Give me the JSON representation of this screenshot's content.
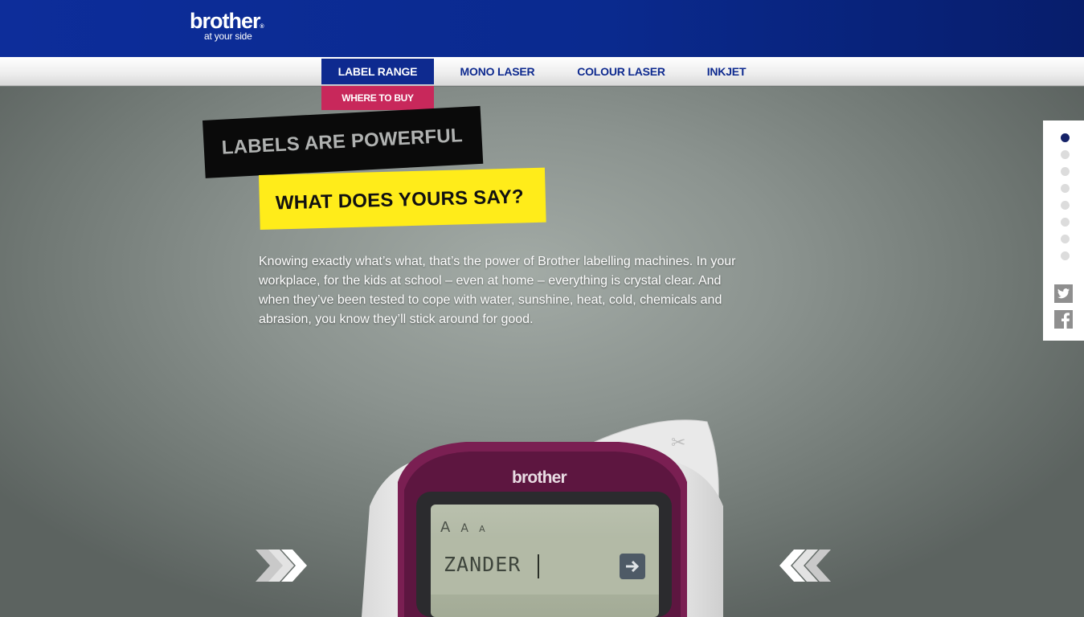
{
  "header": {
    "logo_word": "brother",
    "logo_trademark": "®",
    "logo_tagline": "at your side"
  },
  "nav": {
    "items": [
      {
        "label": "LABEL RANGE",
        "active": true
      },
      {
        "label": "MONO LASER",
        "active": false
      },
      {
        "label": "COLOUR LASER",
        "active": false
      },
      {
        "label": "INKJET",
        "active": false
      }
    ],
    "subnav_label": "WHERE TO BUY"
  },
  "hero": {
    "headline_black": "LABELS ARE POWERFUL",
    "headline_yellow": "WHAT DOES YOURS SAY?",
    "body": "Knowing exactly what’s what, that’s the power of Brother labelling machines. In your workplace, for the kids at school – even at home – everything is crystal clear. And when they’ve been tested to cope with water, sunshine, heat, cold, chemicals and abrasion, you know they’ll stick around for good."
  },
  "device": {
    "brand": "brother",
    "screen_text": "ZANDER",
    "size_marks": [
      "A",
      "A",
      "A"
    ]
  },
  "rail": {
    "dots_count": 8,
    "active_dot": 1,
    "social": [
      {
        "name": "twitter",
        "glyph": "t"
      },
      {
        "name": "facebook",
        "glyph": "f"
      }
    ]
  },
  "colors": {
    "header_blue": "#0e2a8f",
    "subnav_pink": "#c8285b",
    "highlight_yellow": "#ffec1a",
    "device_magenta": "#7a1f52"
  }
}
